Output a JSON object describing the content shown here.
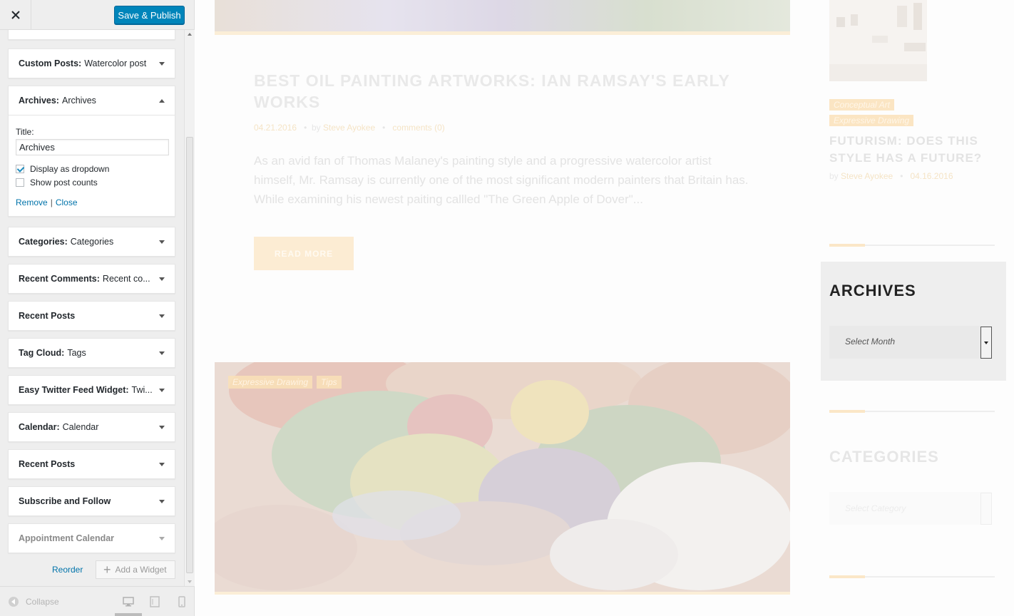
{
  "header": {
    "close_label": "×",
    "save_label": "Save & Publish"
  },
  "widgets": [
    {
      "type": "Custom Posts:",
      "title": "Watercolor post"
    },
    {
      "type": "Archives:",
      "title": "Archives"
    },
    {
      "type": "Categories:",
      "title": "Categories"
    },
    {
      "type": "Recent Comments:",
      "title": "Recent co..."
    },
    {
      "type": "Recent Posts",
      "title": ""
    },
    {
      "type": "Tag Cloud:",
      "title": "Tags"
    },
    {
      "type": "Easy Twitter Feed Widget:",
      "title": "Twi..."
    },
    {
      "type": "Calendar:",
      "title": "Calendar"
    },
    {
      "type": "Recent Posts",
      "title": ""
    },
    {
      "type": "Subscribe and Follow",
      "title": ""
    },
    {
      "type": "Appointment Calendar",
      "title": ""
    }
  ],
  "archives_form": {
    "title_label": "Title:",
    "title_value": "Archives",
    "dropdown_label": "Display as dropdown",
    "dropdown_checked": true,
    "counts_label": "Show post counts",
    "counts_checked": false,
    "remove_label": "Remove",
    "separator": "|",
    "close_label": "Close"
  },
  "footer_actions": {
    "reorder_label": "Reorder",
    "add_widget_label": "Add a Widget"
  },
  "footer": {
    "collapse_label": "Collapse",
    "devices": [
      "desktop-icon",
      "tablet-icon",
      "mobile-icon"
    ],
    "active_device": "desktop"
  },
  "preview": {
    "post": {
      "title": "BEST OIL PAINTING ARTWORKS: IAN RAMSAY'S EARLY WORKS",
      "date": "04.21.2016",
      "by": "by",
      "author": "Steve Ayokee",
      "comments": "comments (0)",
      "excerpt": "As an avid fan of Thomas Malaney's painting style and a progressive watercolor artist himself, Mr. Ramsay is currently one of the most significant modern painters that Britain has. While examining his newest paiting callled \"The Green Apple of Dover\"...",
      "read_more": "READ MORE"
    },
    "image_tags": [
      "Expressive Drawing",
      "Tips"
    ],
    "sidebar": {
      "post_tags": [
        "Conceptual Art",
        "Expressive Drawing"
      ],
      "post_title": "FUTURISM: DOES THIS STYLE HAS A FUTURE?",
      "post_by": "by",
      "post_author": "Steve Ayokee",
      "post_date": "04.16.2016",
      "archives_heading": "ARCHIVES",
      "archives_select": "Select Month",
      "categories_heading": "CATEGORIES",
      "categories_select": "Select Category"
    }
  },
  "colors": {
    "accent": "#0085ba",
    "link": "#0073aa",
    "tag_bg": "#fbe5c3"
  }
}
